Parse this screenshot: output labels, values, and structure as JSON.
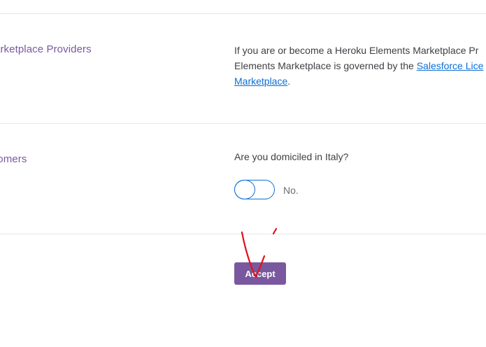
{
  "sections": {
    "providers": {
      "title": "arketplace Providers",
      "text_line1": "If you are or become a Heroku Elements Marketplace Pr",
      "text_line2_prefix": "Elements Marketplace is governed by the ",
      "link1": "Salesforce Lice",
      "link2": "Marketplace",
      "text_line3_suffix": "."
    },
    "customers": {
      "title": "tomers",
      "question": "Are you domiciled in Italy?",
      "toggle_state": "off",
      "toggle_label": "No."
    }
  },
  "actions": {
    "accept_label": "Accept"
  },
  "colors": {
    "purple": "#79589f",
    "link_blue": "#0c6ed6",
    "annotation_red": "#e2101a"
  }
}
